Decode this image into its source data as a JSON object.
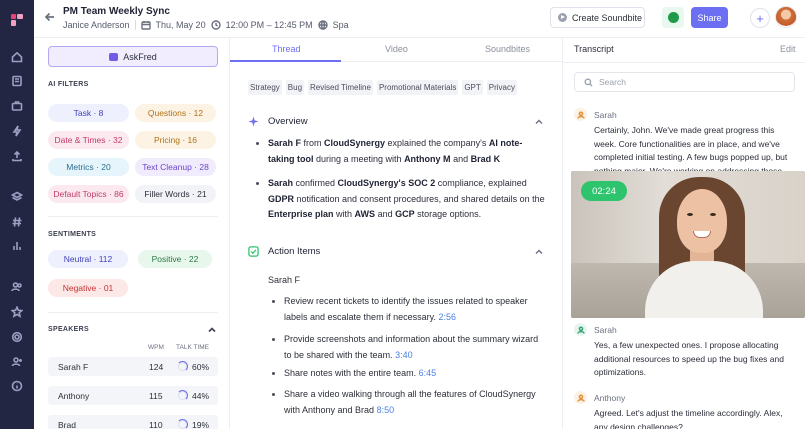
{
  "header": {
    "meeting_title": "PM Team Weekly Sync",
    "host": "Janice Anderson",
    "date": "Thu, May 20",
    "time": "12:00 PM – 12:45 PM",
    "language": "Spa",
    "create_soundbite_label": "Create Soundbite",
    "share_label": "Share",
    "plus_label": "+"
  },
  "filters": {
    "askfred_label": "AskFred",
    "ai_filters_heading": "AI FILTERS",
    "ai_chips": [
      {
        "label": "Task · 8",
        "color": "#eef0fd"
      },
      {
        "label": "Questions · 12",
        "color": "#fdf3e4"
      },
      {
        "label": "Date & Times · 32",
        "color": "#fbe9ef"
      },
      {
        "label": "Pricing · 16",
        "color": "#fdf3e4"
      },
      {
        "label": "Metrics · 20",
        "color": "#e6f5fb"
      },
      {
        "label": "Text Cleanup · 28",
        "color": "#f1ecfd"
      },
      {
        "label": "Default Topics · 86",
        "color": "#fbe9ef"
      },
      {
        "label": "Filler Words · 21",
        "color": "#f2f3f6"
      }
    ],
    "sentiments_heading": "SENTIMENTS",
    "sentiment_chips": [
      {
        "label": "Neutral · 112",
        "color": "#eef0fd"
      },
      {
        "label": "Positive · 22",
        "color": "#e8f7ec"
      },
      {
        "label": "Negative · 01",
        "color": "#fde8e8"
      }
    ],
    "speakers_heading": "SPEAKERS",
    "wpm_header": "WPM",
    "talk_time_header": "TALK TIME",
    "speakers": [
      {
        "name": "Sarah F",
        "wpm": "124",
        "talk": "60%"
      },
      {
        "name": "Anthony",
        "wpm": "115",
        "talk": "44%"
      },
      {
        "name": "Brad",
        "wpm": "110",
        "talk": "19%"
      }
    ]
  },
  "thread": {
    "tabs": [
      "Thread",
      "Video",
      "Soundbites"
    ],
    "active_tab": "Thread",
    "tags": [
      "Strategy",
      "Bug",
      "Revised Timeline",
      "Promotional Materials",
      "GPT",
      "Privacy"
    ],
    "overview_title": "Overview",
    "overview_1": {
      "t1": "Sarah F",
      "t2": " from ",
      "t3": "CloudSynergy",
      "t4": " explained the company's ",
      "t5": "AI note-taking tool",
      "t6": " during a meeting with ",
      "t7": "Anthony M",
      "t8": " and ",
      "t9": "Brad K"
    },
    "overview_2": {
      "t1": "Sarah",
      "t2": " confirmed ",
      "t3": "CloudSynergy's SOC 2",
      "t4": " compliance, explained ",
      "t5": "GDPR",
      "t6": " notification and consent procedures, and shared details on the ",
      "t7": "Enterprise plan",
      "t8": " with ",
      "t9": "AWS",
      "t10": " and ",
      "t11": "GCP",
      "t12": " storage options."
    },
    "action_items_title": "Action Items",
    "action_person": "Sarah F",
    "action_items": [
      {
        "text": "Review recent tickets to identify the issues related to speaker labels and escalate them if necessary.",
        "time": "2:56"
      },
      {
        "text": "Provide screenshots and information about the summary wizard to be shared with the team.",
        "time": "3:40"
      },
      {
        "text": "Share notes with the entire team.",
        "time": "6:45"
      },
      {
        "text": "Share a video walking through all the features of CloudSynergy with Anthony and Brad",
        "time": "8:50"
      }
    ]
  },
  "transcript": {
    "title": "Transcript",
    "edit_label": "Edit",
    "search_placeholder": "Search",
    "entries": [
      {
        "speaker": "Sarah",
        "text": "Certainly, John. We've made great progress this week. Core functionalities are in place, and we've completed initial testing. A few bugs popped up, but nothing major. We're working on addressing those."
      },
      {
        "speaker": "Sarah",
        "text": "Yes, a few unexpected ones. I propose allocating additional resources to speed up the bug fixes and optimizations."
      },
      {
        "speaker": "Anthony",
        "text": "Agreed. Let's adjust the timeline accordingly. Alex, any design challenges?"
      }
    ],
    "video_timer": "02:24"
  }
}
